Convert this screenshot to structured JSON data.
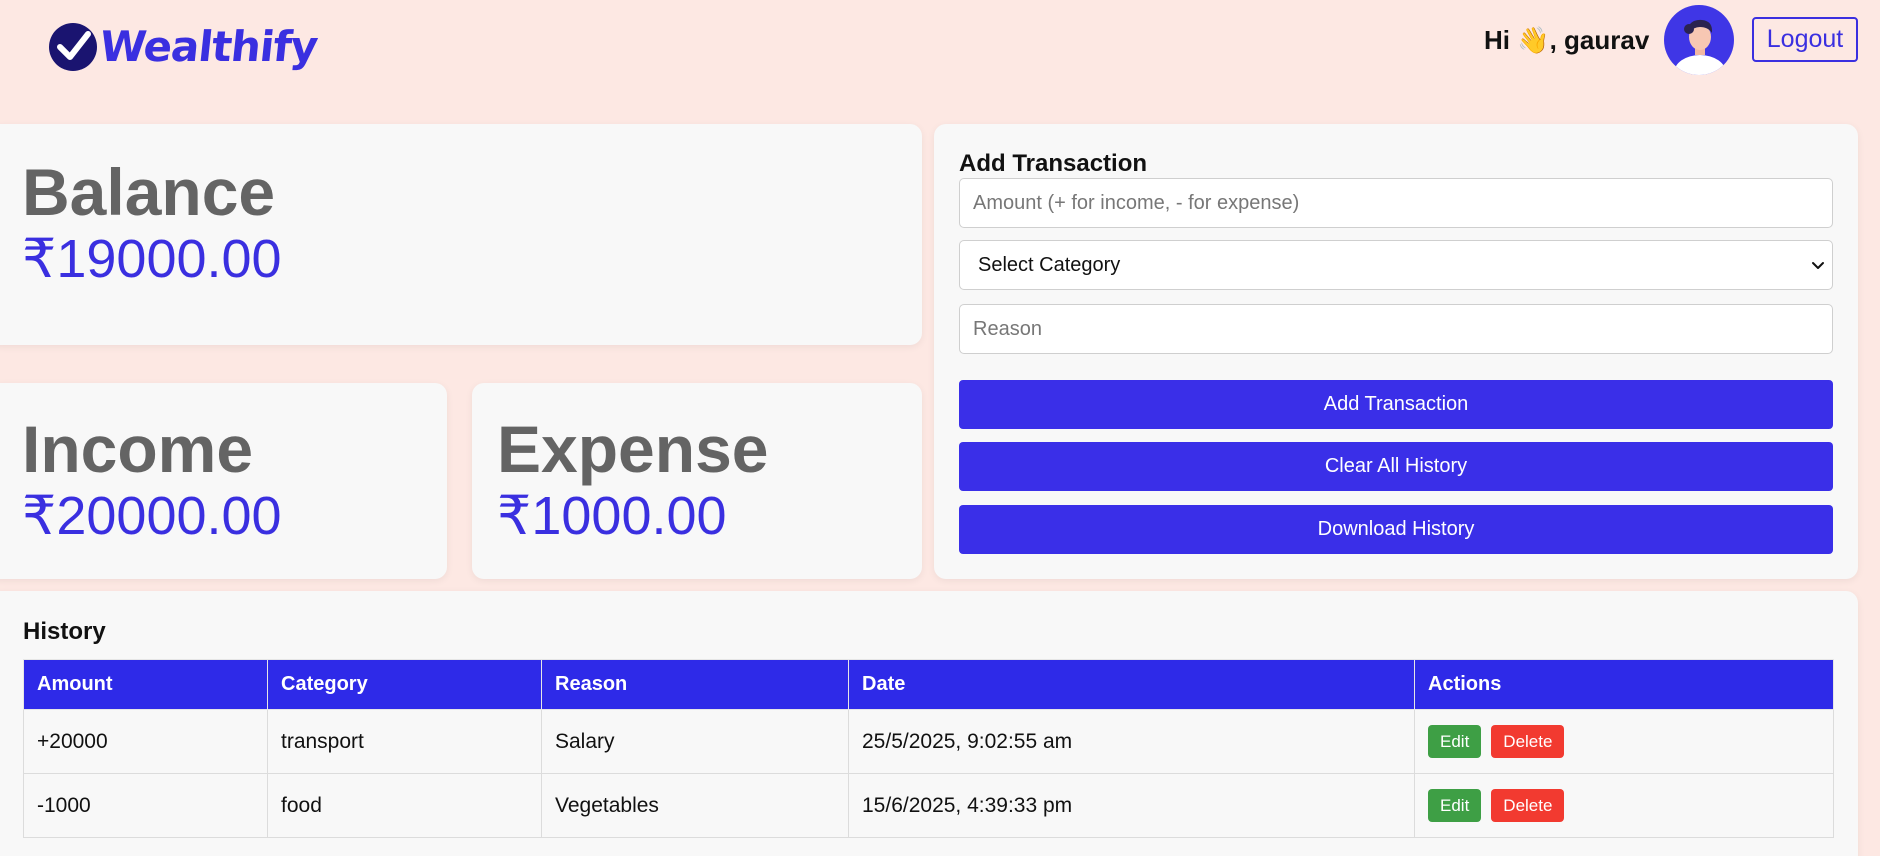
{
  "app": {
    "name": "Wealthify"
  },
  "header": {
    "greeting": "Hi 👋, gaurav",
    "logout_label": "Logout"
  },
  "colors": {
    "accent": "#3a2fe0",
    "background": "#fde8e3",
    "edit": "#3e9f45",
    "delete": "#f23a30"
  },
  "summary": {
    "balance": {
      "label": "Balance",
      "value": "₹19000.00"
    },
    "income": {
      "label": "Income",
      "value": "₹20000.00"
    },
    "expense": {
      "label": "Expense",
      "value": "₹1000.00"
    }
  },
  "add_transaction": {
    "title": "Add Transaction",
    "amount_placeholder": "Amount (+ for income, - for expense)",
    "category_selected": "Select Category",
    "reason_placeholder": "Reason",
    "add_label": "Add Transaction",
    "clear_label": "Clear All History",
    "download_label": "Download History"
  },
  "history": {
    "title": "History",
    "columns": [
      "Amount",
      "Category",
      "Reason",
      "Date",
      "Actions"
    ],
    "edit_label": "Edit",
    "delete_label": "Delete",
    "rows": [
      {
        "amount": "+20000",
        "category": "transport",
        "reason": "Salary",
        "date": "25/5/2025, 9:02:55 am"
      },
      {
        "amount": "-1000",
        "category": "food",
        "reason": "Vegetables",
        "date": "15/6/2025, 4:39:33 pm"
      }
    ]
  }
}
